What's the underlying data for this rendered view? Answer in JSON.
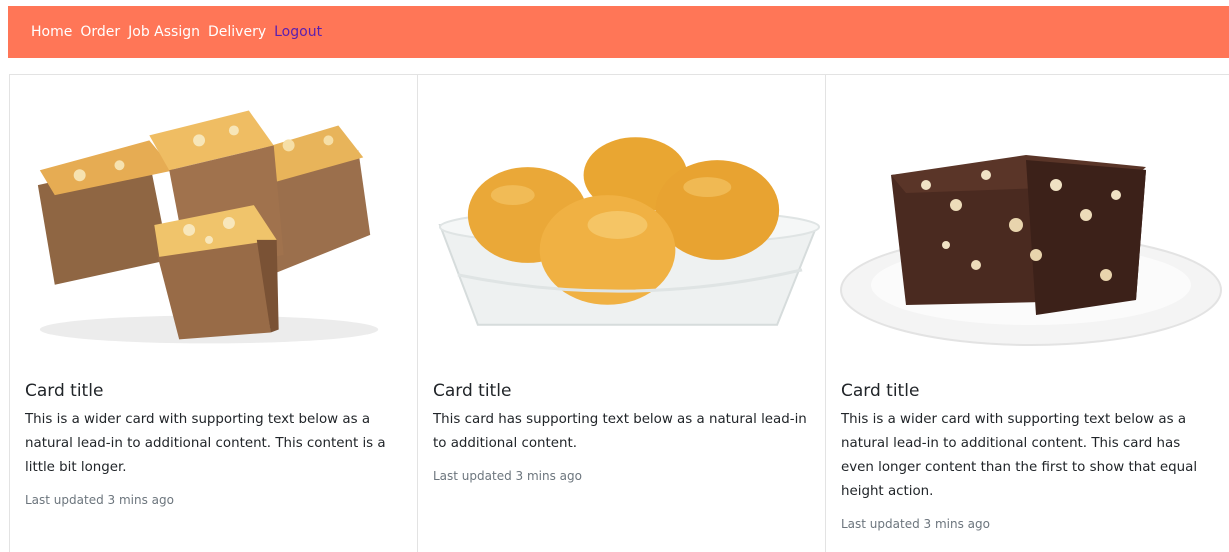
{
  "nav": {
    "items": [
      {
        "label": "Home"
      },
      {
        "label": "Order"
      },
      {
        "label": "Job Assign"
      },
      {
        "label": "Delivery"
      },
      {
        "label": "Logout"
      }
    ]
  },
  "cards": [
    {
      "image": "cake-squares-image",
      "title": "Card title",
      "text": "This is a wider card with supporting text below as a natural lead-in to additional content. This content is a little bit longer.",
      "updated": "Last updated 3 mins ago"
    },
    {
      "image": "buns-in-tray-image",
      "title": "Card title",
      "text": "This card has supporting text below as a natural lead-in to additional content.",
      "updated": "Last updated 3 mins ago"
    },
    {
      "image": "brownie-on-plate-image",
      "title": "Card title",
      "text": "This is a wider card with supporting text below as a natural lead-in to additional content. This card has even longer content than the first to show that equal height action.",
      "updated": "Last updated 3 mins ago"
    }
  ],
  "colors": {
    "navbar": "#ff7657",
    "nav_text": "#ffffff",
    "logout_text": "#5a1fb0",
    "muted_text": "#6c757d"
  }
}
